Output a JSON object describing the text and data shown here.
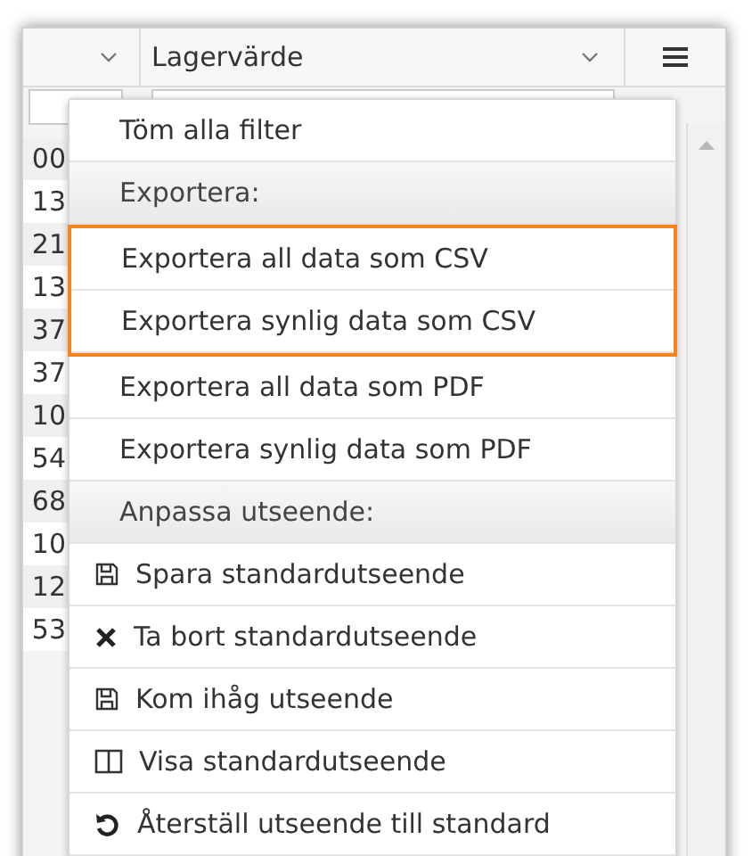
{
  "grid": {
    "column_2": {
      "label": "Lagervärde"
    },
    "column_1_cells": [
      "00",
      "13",
      "21",
      "13",
      "37",
      "37",
      "10",
      "54",
      "68",
      "10",
      "12",
      "53"
    ]
  },
  "menu": {
    "items": [
      {
        "kind": "action",
        "label": "Töm alla filter",
        "highlighted": false
      },
      {
        "kind": "header",
        "label": "Exportera:",
        "highlighted": false
      },
      {
        "kind": "action",
        "label": "Exportera all data som CSV",
        "highlighted": true
      },
      {
        "kind": "action",
        "label": "Exportera synlig data som CSV",
        "highlighted": true
      },
      {
        "kind": "action",
        "label": "Exportera all data som PDF",
        "highlighted": false
      },
      {
        "kind": "action",
        "label": "Exportera synlig data som PDF",
        "highlighted": false
      },
      {
        "kind": "header",
        "label": "Anpassa utseende:",
        "highlighted": false
      },
      {
        "kind": "save",
        "label": "Spara standardutseende",
        "highlighted": false
      },
      {
        "kind": "remove",
        "label": "Ta bort standardutseende",
        "highlighted": false
      },
      {
        "kind": "save",
        "label": "Kom ihåg utseende",
        "highlighted": false
      },
      {
        "kind": "columns",
        "label": "Visa standardutseende",
        "highlighted": false
      },
      {
        "kind": "reset",
        "label": "Återställ utseende till standard",
        "highlighted": false
      }
    ]
  }
}
